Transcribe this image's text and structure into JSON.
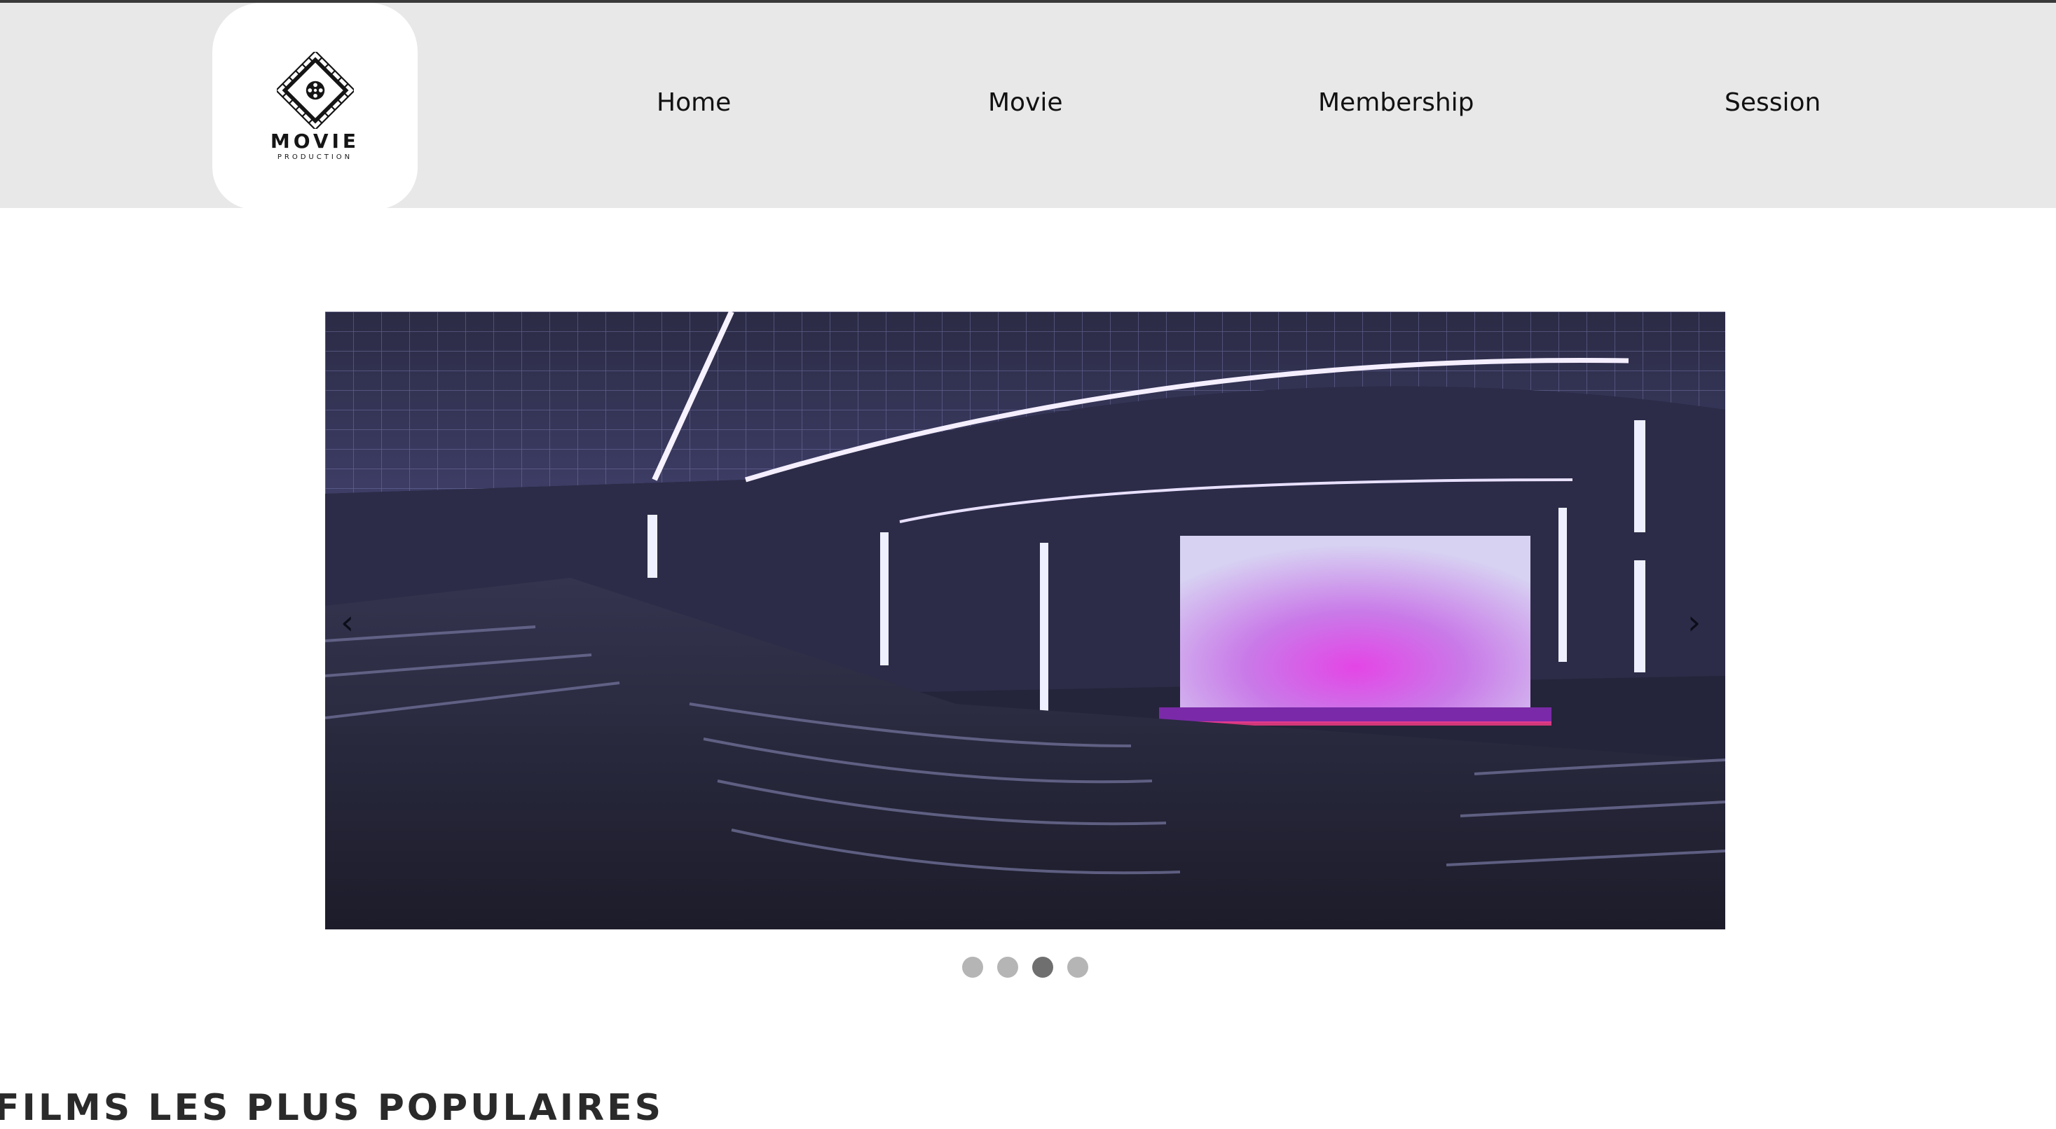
{
  "header": {
    "logo": {
      "title": "MOVIE",
      "subtitle": "PRODUCTION",
      "icon": "film-reel-icon"
    },
    "nav": [
      {
        "label": "Home"
      },
      {
        "label": "Movie"
      },
      {
        "label": "Membership"
      },
      {
        "label": "Session"
      }
    ]
  },
  "carousel": {
    "image": "cinema-auditorium-photo",
    "prev_label": "‹",
    "next_label": "›",
    "slide_count": 4,
    "active_slide": 3
  },
  "section": {
    "title": "FILMS LES PLUS POPULAIRES"
  },
  "colors": {
    "header_bg": "#e8e8e8",
    "dot": "#b5b5b5",
    "dot_active": "#6f6f6f"
  }
}
